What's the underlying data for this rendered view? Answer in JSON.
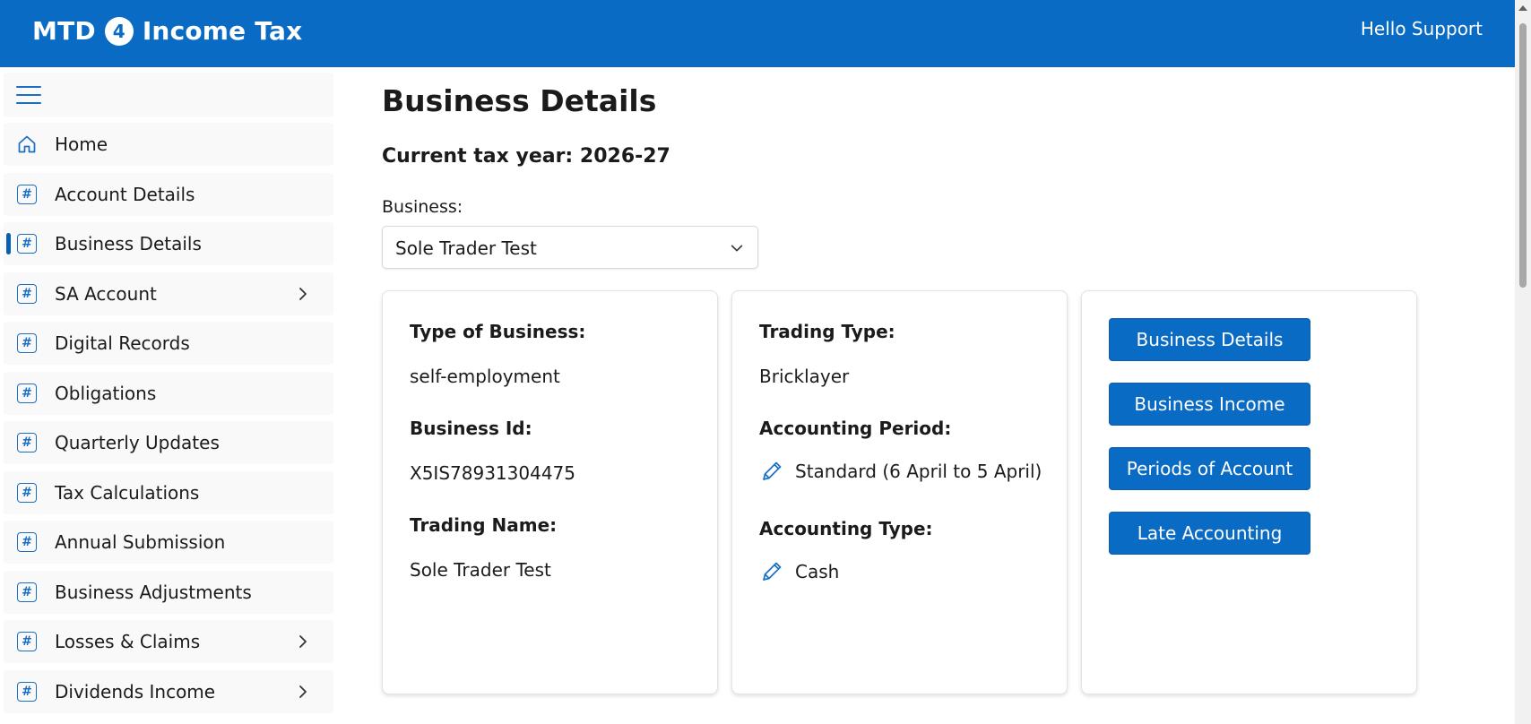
{
  "header": {
    "brand_prefix": "MTD",
    "brand_number": "4",
    "brand_suffix": "Income Tax",
    "greeting": "Hello Support"
  },
  "sidebar": {
    "items": [
      {
        "label": "Home",
        "icon": "home-icon",
        "has_chevron": false,
        "active": false
      },
      {
        "label": "Account Details",
        "icon": "hash-icon",
        "has_chevron": false,
        "active": false
      },
      {
        "label": "Business Details",
        "icon": "hash-icon",
        "has_chevron": false,
        "active": true
      },
      {
        "label": "SA Account",
        "icon": "hash-icon",
        "has_chevron": true,
        "active": false
      },
      {
        "label": "Digital Records",
        "icon": "hash-icon",
        "has_chevron": false,
        "active": false
      },
      {
        "label": "Obligations",
        "icon": "hash-icon",
        "has_chevron": false,
        "active": false
      },
      {
        "label": "Quarterly Updates",
        "icon": "hash-icon",
        "has_chevron": false,
        "active": false
      },
      {
        "label": "Tax Calculations",
        "icon": "hash-icon",
        "has_chevron": false,
        "active": false
      },
      {
        "label": "Annual Submission",
        "icon": "hash-icon",
        "has_chevron": false,
        "active": false
      },
      {
        "label": "Business Adjustments",
        "icon": "hash-icon",
        "has_chevron": false,
        "active": false
      },
      {
        "label": "Losses & Claims",
        "icon": "hash-icon",
        "has_chevron": true,
        "active": false
      },
      {
        "label": "Dividends Income",
        "icon": "hash-icon",
        "has_chevron": true,
        "active": false
      }
    ]
  },
  "main": {
    "title": "Business Details",
    "tax_year": "Current tax year: 2026-27",
    "business_label": "Business:",
    "business_selected": "Sole Trader Test",
    "card1": {
      "type_label": "Type of Business:",
      "type_value": "self-employment",
      "id_label": "Business Id:",
      "id_value": "X5IS78931304475",
      "trading_name_label": "Trading Name:",
      "trading_name_value": "Sole Trader Test"
    },
    "card2": {
      "trading_type_label": "Trading Type:",
      "trading_type_value": "Bricklayer",
      "accounting_period_label": "Accounting Period:",
      "accounting_period_value": "Standard (6 April to 5 April)",
      "accounting_type_label": "Accounting Type:",
      "accounting_type_value": "Cash"
    },
    "buttons": [
      "Business Details",
      "Business Income",
      "Periods of Account",
      "Late Accounting"
    ]
  },
  "colors": {
    "brand": "#0a6bc4",
    "sidebar_item_bg": "#f9f9f9",
    "accent_icon": "#1a6fc4"
  }
}
